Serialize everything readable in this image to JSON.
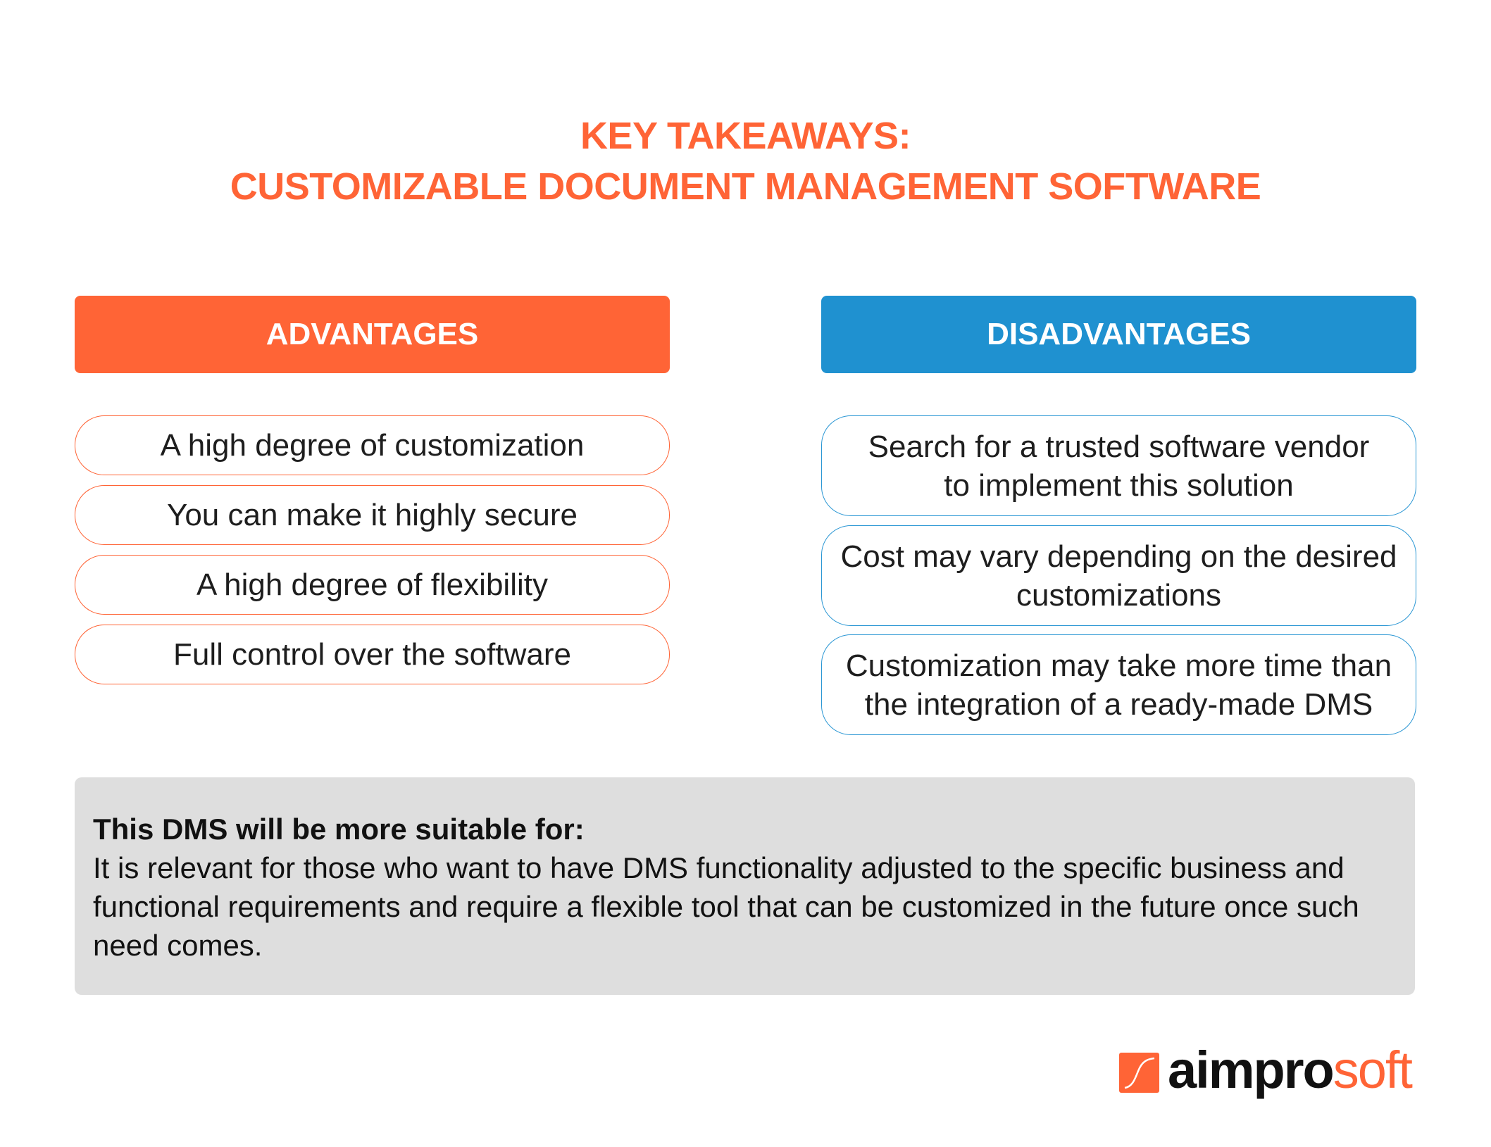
{
  "title": {
    "line1": "KEY TAKEAWAYS:",
    "line2": "CUSTOMIZABLE DOCUMENT MANAGEMENT SOFTWARE"
  },
  "advantages": {
    "header": "ADVANTAGES",
    "items": [
      "A high degree of customization",
      "You can make it highly secure",
      "A high degree of flexibility",
      "Full control over the software"
    ]
  },
  "disadvantages": {
    "header": "DISADVANTAGES",
    "items": [
      "Search for a trusted software vendor to implement this solution",
      "Cost may vary depending on the desired customizations",
      "Customization may take more time than the integration of a ready-made DMS"
    ]
  },
  "note": {
    "title": "This DMS will be more suitable for:",
    "body": "It is relevant for those who want to have DMS functionality adjusted to the specific business and functional requirements and require a flexible tool that can be customized in the future once such need comes."
  },
  "logo": {
    "part1": "aimpro",
    "part2": "soft",
    "icon": "logo-mark-icon"
  },
  "colors": {
    "accent_orange": "#ff6436",
    "accent_blue": "#1f91d0",
    "note_background": "#dedede"
  }
}
